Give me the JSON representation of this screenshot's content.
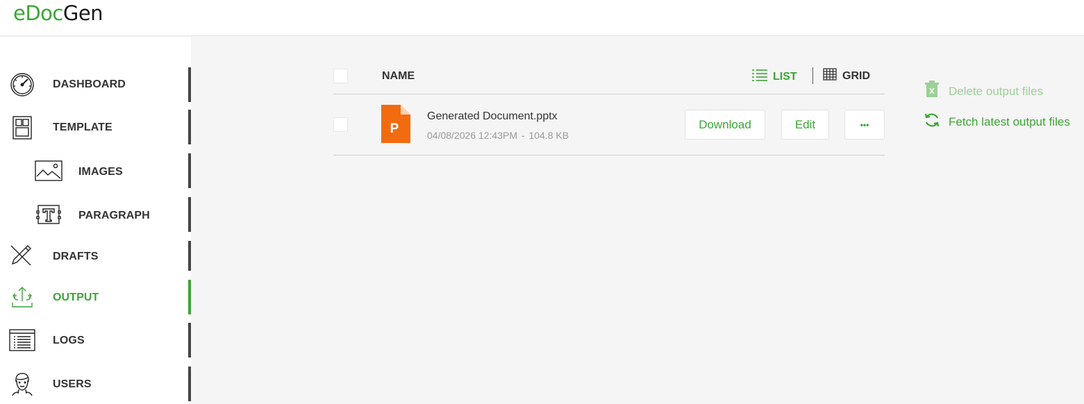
{
  "app": {
    "logo_part1": "eDoc",
    "logo_part2": "Gen"
  },
  "sidebar": {
    "items": [
      {
        "label": "DASHBOARD",
        "icon": "speedometer-icon"
      },
      {
        "label": "TEMPLATE",
        "icon": "template-icon"
      },
      {
        "label": "IMAGES",
        "icon": "image-icon"
      },
      {
        "label": "PARAGRAPH",
        "icon": "text-box-icon"
      },
      {
        "label": "DRAFTS",
        "icon": "pencil-icon"
      },
      {
        "label": "OUTPUT",
        "icon": "upload-share-icon",
        "active": true
      },
      {
        "label": "LOGS",
        "icon": "log-list-icon"
      },
      {
        "label": "USERS",
        "icon": "user-icon"
      }
    ]
  },
  "list": {
    "header_name": "NAME",
    "view_list": "LIST",
    "view_grid": "GRID",
    "files": [
      {
        "name": "Generated Document.pptx",
        "date": "04/08/2026 12:43PM",
        "sep": "-",
        "size": "104.8 KB",
        "type_letter": "P",
        "download": "Download",
        "edit": "Edit",
        "more": "•••"
      }
    ]
  },
  "actions": {
    "delete": "Delete output files",
    "fetch": "Fetch latest output files"
  },
  "colors": {
    "accent": "#3aa635",
    "accent_disabled": "#9bd097",
    "ppt_orange": "#f26b0f"
  }
}
